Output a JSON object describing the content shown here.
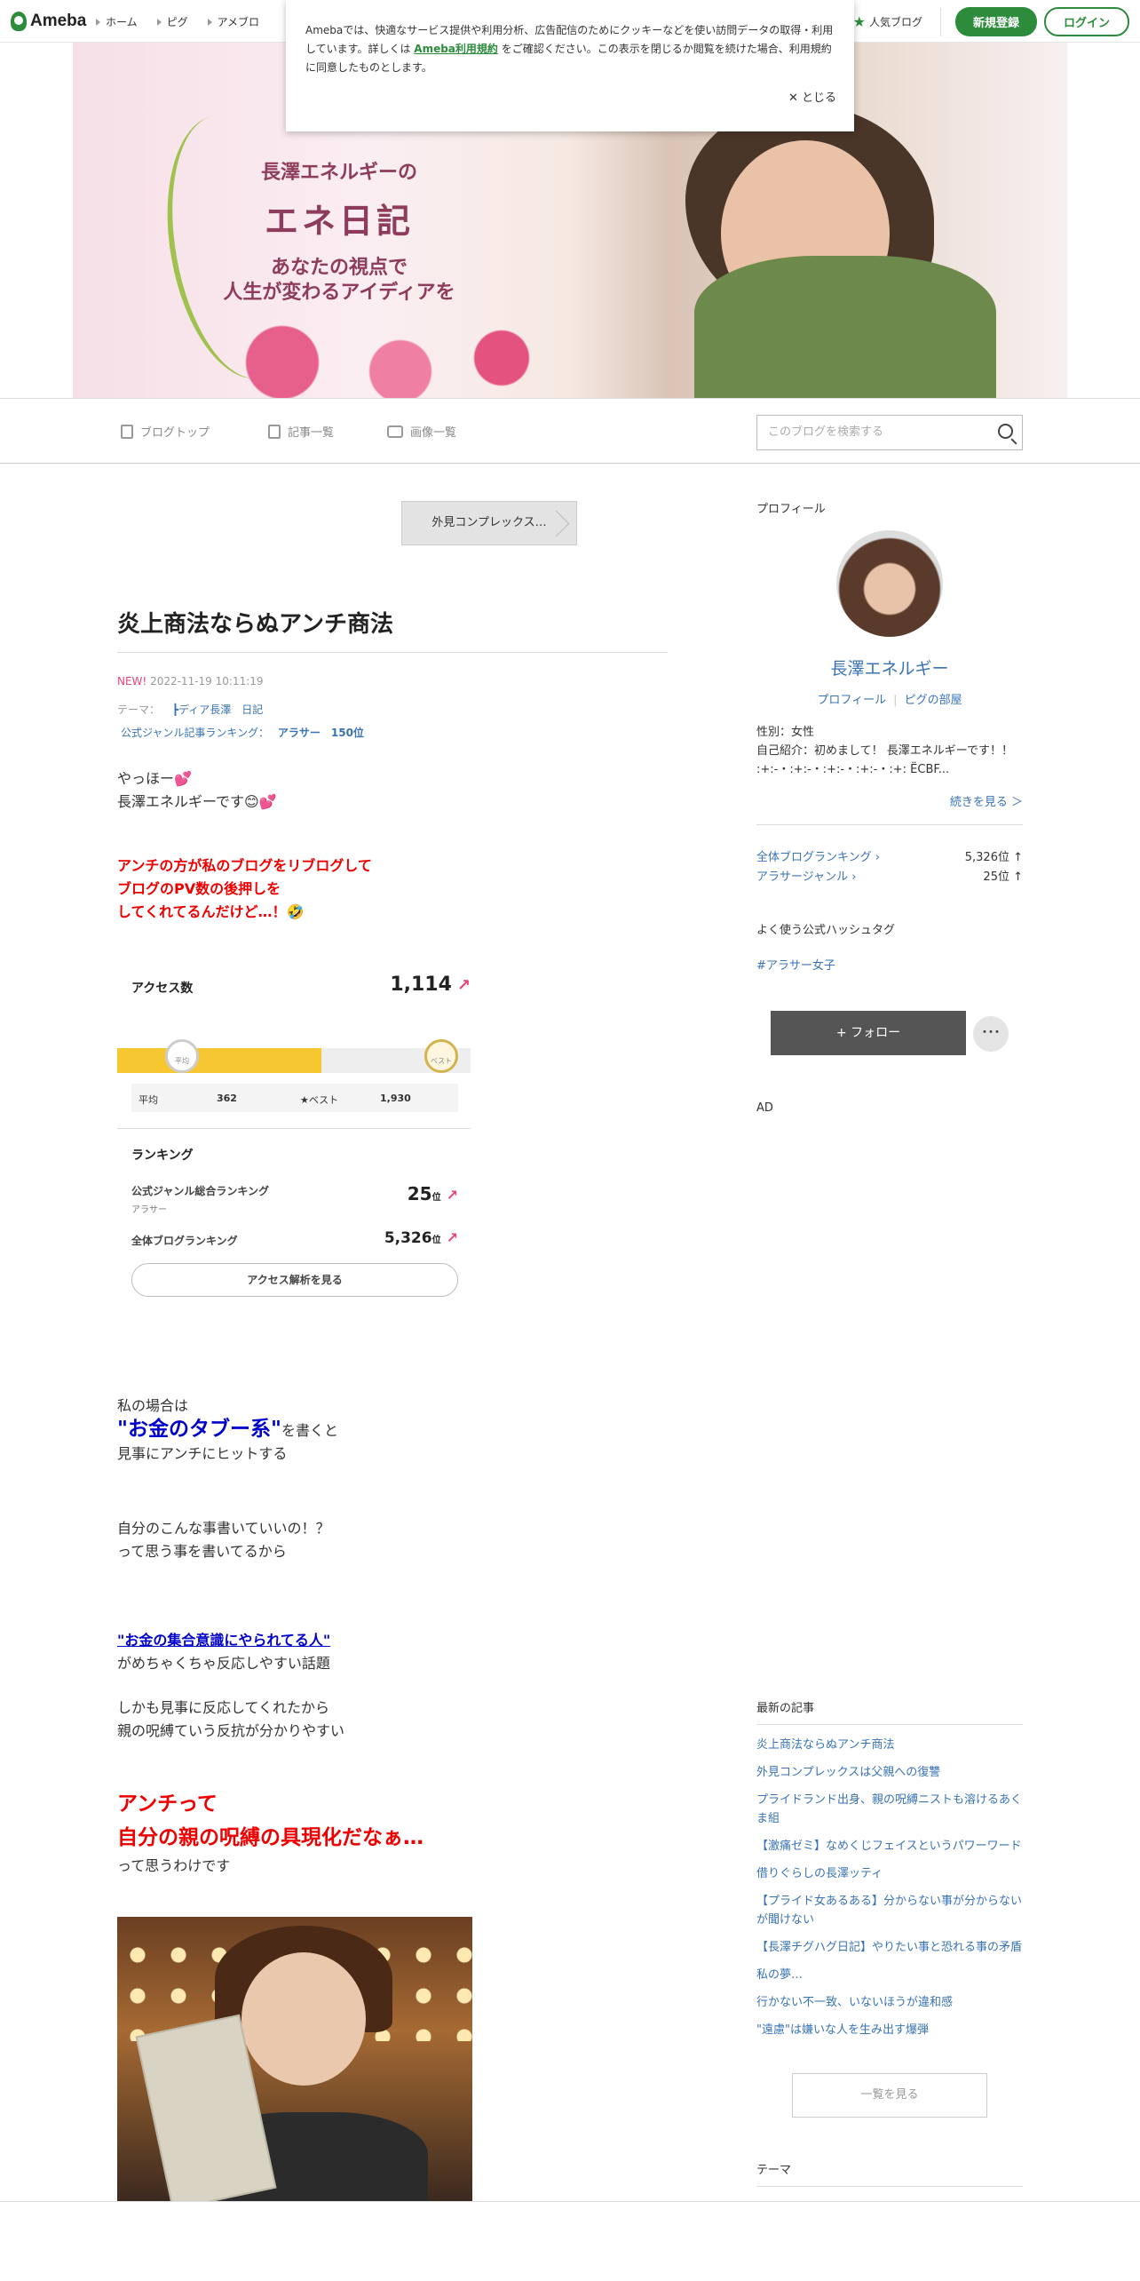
{
  "header": {
    "logo": "Ameba",
    "nav": [
      "ホーム",
      "ピグ",
      "アメブロ"
    ],
    "popular": "人気ブログ",
    "signup": "新規登録",
    "login": "ログイン"
  },
  "cookie": {
    "text_before": "Amebaでは、快適なサービス提供や利用分析、広告配信のためにクッキーなどを使い訪問データの取得・利用しています。詳しくは",
    "link": "Ameba利用規約",
    "text_after": "をご確認ください。この表示を閉じるか閲覧を続けた場合、利用規約に同意したものとします。",
    "close": "✕ とじる"
  },
  "banner": {
    "line1": "長澤エネルギーの",
    "line2": "エネ日記",
    "line3": "あなたの視点で",
    "line4": "人生が変わるアイディアを"
  },
  "subnav": {
    "top": "ブログトップ",
    "list": "記事一覧",
    "images": "画像一覧",
    "search_placeholder": "このブログを検索する"
  },
  "article": {
    "prev_tag": "外見コンプレックス…",
    "title": "炎上商法ならぬアンチ商法",
    "new_badge": "NEW!",
    "date": "2022-11-19 10:11:19",
    "theme_label": "テーマ：",
    "theme_value": "┣ディア長澤　日記",
    "rank_label": "公式ジャンル記事ランキング：",
    "rank_value": "アラサー　150位",
    "p1a": "やっほー💕",
    "p1b": "長澤エネルギーです😊💕",
    "p2a": "アンチの方が私のブログをリブログして",
    "p2b": "ブログのPV数の後押しを",
    "p2c": "してくれてるんだけど…！🤣",
    "p3a": "私の場合は",
    "p3b": "\"お金のタブー系\"",
    "p3c": "を書くと",
    "p3d": "見事にアンチにヒットする",
    "p4a": "自分のこんな事書いていいの！？",
    "p4b": "って思う事を書いてるから",
    "p5a": "\"お金の集合意識にやられてる人\"",
    "p5b": "がめちゃくちゃ反応しやすい話題",
    "p6a": "しかも見事に反応してくれたから",
    "p6b": "親の呪縛ていう反抗が分かりやすい",
    "p7a": "アンチって",
    "p7b": "自分の親の呪縛の具現化だなぁ…",
    "p7c": "って思うわけです"
  },
  "access": {
    "label": "アクセス数",
    "value": "1,114",
    "trend": "↗",
    "fill_fraction": 0.577,
    "avg_marker": "平均",
    "best_marker": "ベスト",
    "avg_label": "平均",
    "avg_value": "362",
    "best_label": "★ベスト",
    "best_value": "1,930",
    "ranking_title": "ランキング",
    "genre_label": "公式ジャンル総合ランキング",
    "genre_sub": "アラサー",
    "genre_value": "25",
    "genre_unit": "位",
    "all_label": "全体ブログランキング",
    "all_value": "5,326",
    "all_unit": "位",
    "button": "アクセス解析を見る"
  },
  "sidebar": {
    "profile_title": "プロフィール",
    "name": "長澤エネルギー",
    "profile_link": "プロフィール",
    "room_link": "ピグの部屋",
    "gender": "性別：女性",
    "intro": "自己紹介：初めまして！ 長澤エネルギーです！！ :+:-・:+:-・:+:-・:+:-・:+: ЁCBF...",
    "more": "続きを見る ＞",
    "rank_all_label": "全体ブログランキング",
    "rank_all_value": "5,326位 ↑",
    "rank_genre_label": "アラサージャンル",
    "rank_genre_value": "25位 ↑",
    "hashtag_title": "よく使う公式ハッシュタグ",
    "hashtag": "#アラサー女子",
    "follow": "+ フォロー",
    "more_dots": "･･･",
    "ad": "AD",
    "latest_title": "最新の記事",
    "latest": [
      "炎上商法ならぬアンチ商法",
      "外見コンプレックスは父親への復讐",
      "プライドランド出身、親の呪縛ニストも溶けるあくま組",
      "【激痛ゼミ】なめくじフェイスというパワーワード",
      "借りぐらしの長澤ッティ",
      "【プライド女あるある】分からない事が分からないが聞けない",
      "【長澤チグハグ日記】やりたい事と恐れる事の矛盾",
      "私の夢…",
      "行かない不一致、いないほうが違和感",
      "\"遠慮\"は嫌いな人を生み出す爆弾"
    ],
    "all_button": "一覧を見る",
    "theme_title": "テーマ"
  }
}
